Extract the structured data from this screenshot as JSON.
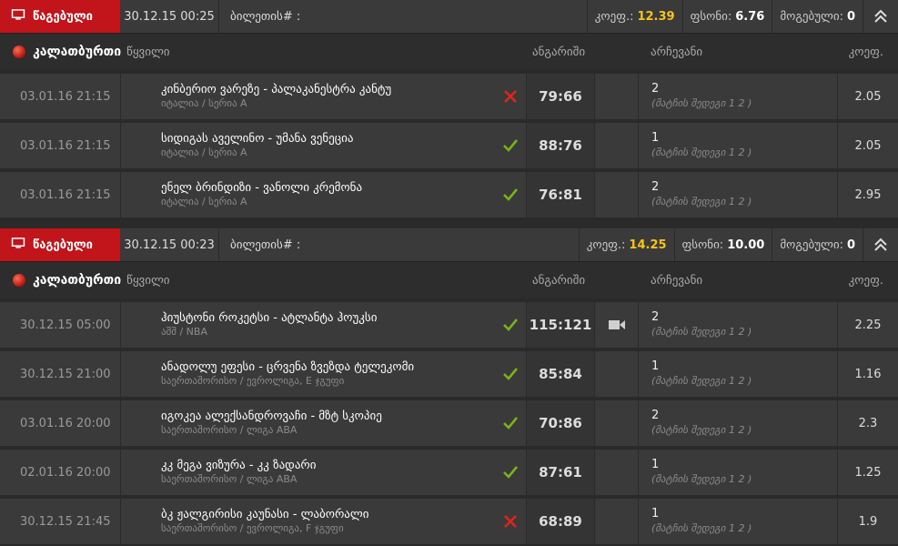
{
  "icons": {
    "status": "monitor-icon",
    "collapse": "double-chevron-up-icon",
    "sport": "basketball-icon",
    "win": "check-icon",
    "loss": "cross-icon",
    "video": "video-camera-icon"
  },
  "colors": {
    "status_bg": "#c1141b",
    "coef_highlight": "#f5c518",
    "win": "#7ab317",
    "loss": "#e0251b"
  },
  "tickets": [
    {
      "status": "წაგებული",
      "date": "30.12.15 00:25",
      "ticket_label": "ბილეთის# :",
      "coef_label": "კოეფ.:",
      "coef_value": "12.39",
      "stake_label": "ფსონი:",
      "stake_value": "6.76",
      "win_label": "მოგებული:",
      "win_value": "0",
      "sport": "კალათბურთი",
      "period": "წყვილი",
      "col_score": "ანგარიში",
      "col_choice": "არჩევანი",
      "col_coef": "კოეფ.",
      "matches": [
        {
          "date": "03.01.16 21:15",
          "teams": "კინბერიო ვარეზე - პალაკანესტრა კანტუ",
          "league": "იტალია / სერია A",
          "result": "loss",
          "score": "79:66",
          "video": false,
          "pick": "2",
          "pick_type": "(მატჩის შედეგი 1 2 )",
          "coef": "2.05"
        },
        {
          "date": "03.01.16 21:15",
          "teams": "სიდიგას აველინო - უმანა ვენეცია",
          "league": "იტალია / სერია A",
          "result": "win",
          "score": "88:76",
          "video": false,
          "pick": "1",
          "pick_type": "(მატჩის შედეგი 1 2 )",
          "coef": "2.05"
        },
        {
          "date": "03.01.16 21:15",
          "teams": "ენელ ბრინდიზი - ვანოლი კრემონა",
          "league": "იტალია / სერია A",
          "result": "win",
          "score": "76:81",
          "video": false,
          "pick": "2",
          "pick_type": "(მატჩის შედეგი 1 2 )",
          "coef": "2.95"
        }
      ]
    },
    {
      "status": "წაგებული",
      "date": "30.12.15 00:23",
      "ticket_label": "ბილეთის# :",
      "coef_label": "კოეფ.:",
      "coef_value": "14.25",
      "stake_label": "ფსონი:",
      "stake_value": "10.00",
      "win_label": "მოგებული:",
      "win_value": "0",
      "sport": "კალათბურთი",
      "period": "წყვილი",
      "col_score": "ანგარიში",
      "col_choice": "არჩევანი",
      "col_coef": "კოეფ.",
      "matches": [
        {
          "date": "30.12.15 05:00",
          "teams": "ჰიუსტონი როკეტსი - ატლანტა ჰოუკსი",
          "league": "აშშ / NBA",
          "result": "win",
          "score": "115:121",
          "video": true,
          "pick": "2",
          "pick_type": "(მატჩის შედეგი 1 2 )",
          "coef": "2.25"
        },
        {
          "date": "30.12.15 21:00",
          "teams": "ანადოლუ ეფესი - ცრვენა ზვეზდა ტელეკომი",
          "league": "საერთაშორისო / ევროლიგა, E ჯგუფი",
          "result": "win",
          "score": "85:84",
          "video": false,
          "pick": "1",
          "pick_type": "(მატჩის შედეგი 1 2 )",
          "coef": "1.16"
        },
        {
          "date": "03.01.16 20:00",
          "teams": "იგოკეა ალექსანდროვაჩი - მზტ სკოპიე",
          "league": "საერთაშორისო / ლიგა ABA",
          "result": "win",
          "score": "70:86",
          "video": false,
          "pick": "2",
          "pick_type": "(მატჩის შედეგი 1 2 )",
          "coef": "2.3"
        },
        {
          "date": "02.01.16 20:00",
          "teams": "კკ მეგა ვიზურა - კკ ზადარი",
          "league": "საერთაშორისო / ლიგა ABA",
          "result": "win",
          "score": "87:61",
          "video": false,
          "pick": "1",
          "pick_type": "(მატჩის შედეგი 1 2 )",
          "coef": "1.25"
        },
        {
          "date": "30.12.15 21:45",
          "teams": "ბკ ჟალგირისი კაუნასი - ლაბორალი",
          "league": "საერთაშორისო / ევროლიგა, F ჯგუფი",
          "result": "loss",
          "score": "68:89",
          "video": false,
          "pick": "1",
          "pick_type": "(მატჩის შედეგი 1 2 )",
          "coef": "1.9"
        }
      ]
    }
  ]
}
